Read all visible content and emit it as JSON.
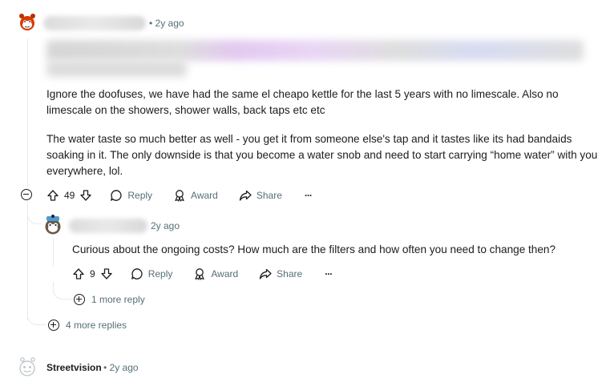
{
  "top_comment": {
    "time": "• 2y ago",
    "paragraph1": "Ignore the doofuses, we have had the same el cheapo kettle for the last 5 years with no limescale. Also no limescale on the showers, shower walls, back taps etc etc",
    "paragraph2": "The water taste so much better as well - you get it from someone else's tap and it tastes like its had bandaids soaking in it. The only downside is that you become a water snob and need to start carrying “home water” with you everywhere, lol.",
    "score": "49",
    "reply_label": "Reply",
    "award_label": "Award",
    "share_label": "Share",
    "more_label": "···"
  },
  "reply_comment": {
    "time": "2y ago",
    "text": "Curious about the ongoing costs? How much are the filters and how often you need to change then?",
    "score": "9",
    "reply_label": "Reply",
    "award_label": "Award",
    "share_label": "Share",
    "more_label": "···",
    "more_replies": "1 more reply"
  },
  "thread": {
    "more_replies": "4 more replies"
  },
  "next_comment": {
    "author": "Streetvision",
    "time": "• 2y ago"
  },
  "colors": {
    "accent_red": "#d93a00",
    "meta_gray": "#576f76"
  }
}
